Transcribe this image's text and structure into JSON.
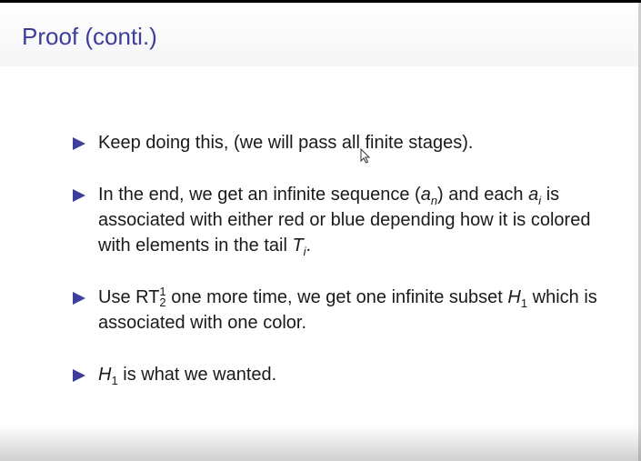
{
  "slide": {
    "title": "Proof (conti.)"
  },
  "bullets": {
    "b1": {
      "text": "Keep doing this, (we will pass all finite stages)."
    },
    "b2": {
      "part1": "In the end, we get an infinite sequence (",
      "a": "a",
      "n": "n",
      "part2": ") and each ",
      "ai": "a",
      "i": "i",
      "part3": " is associated with either red or blue depending how it is colored with elements in the tail ",
      "T": "T",
      "Ti": "i",
      "part4": "."
    },
    "b3": {
      "part1": "Use RT",
      "sup": "1",
      "sub": "2",
      "part2": " one more time, we get one infinite subset ",
      "H": "H",
      "H_sub": "1",
      "part3": " which is associated with one color."
    },
    "b4": {
      "H": "H",
      "H_sub": "1",
      "part1": " is what we wanted."
    }
  },
  "colors": {
    "accent": "#3d3d9b",
    "text": "#1a1a1a"
  },
  "icons": {
    "bullet": "triangle-right-icon",
    "cursor": "mouse-pointer-icon"
  }
}
